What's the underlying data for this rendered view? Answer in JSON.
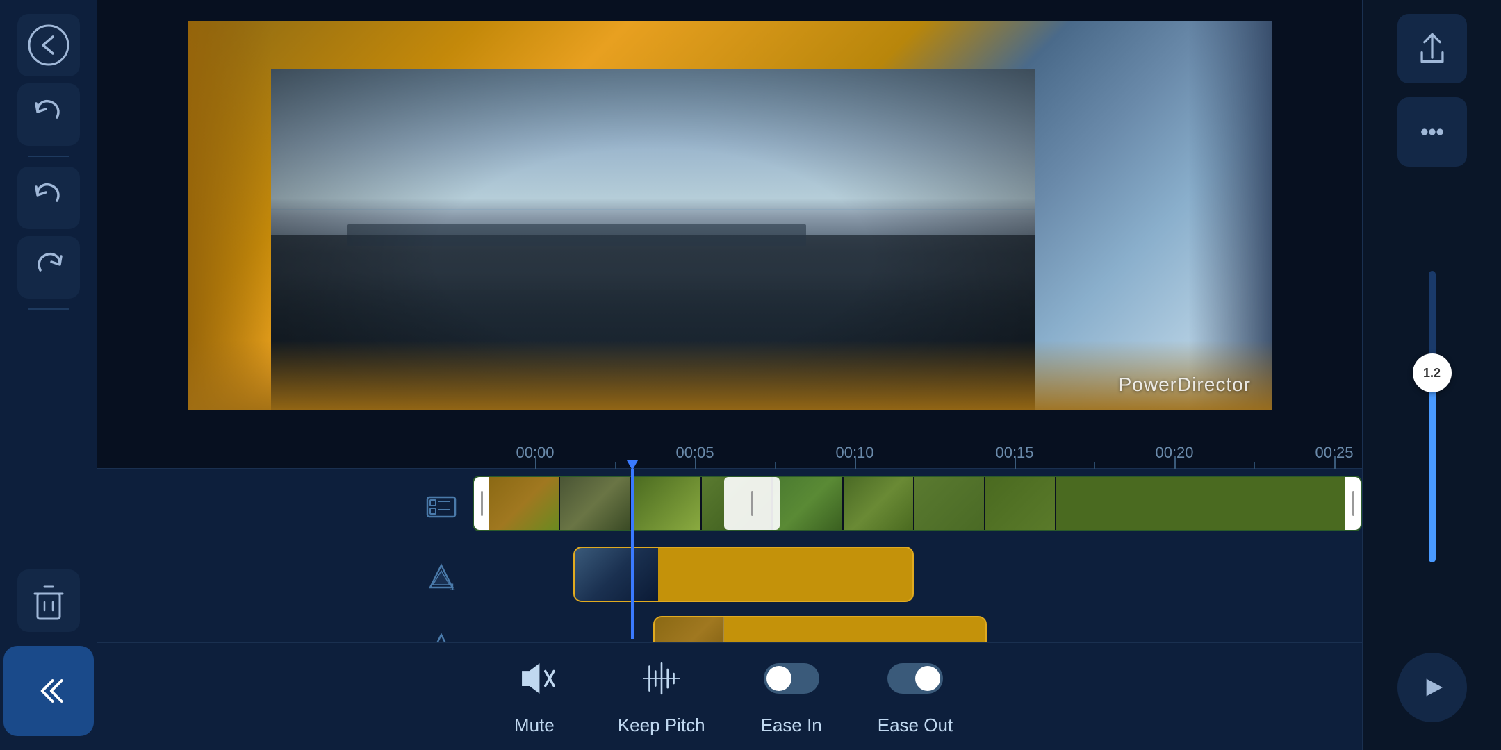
{
  "app": {
    "title": "PowerDirector",
    "watermark": "PowerDirector"
  },
  "sidebar": {
    "back_icon": "←",
    "undo_icon": "↩",
    "redo_icon": "↪",
    "delete_icon": "🗑",
    "collapse_icon": "«"
  },
  "right_panel": {
    "share_icon": "⬆",
    "more_icon": "•••",
    "volume_value": "1.2",
    "play_icon": "▶"
  },
  "timeline": {
    "ruler_marks": [
      "00:00",
      "00:05",
      "00:10",
      "00:15",
      "00:20",
      "00:25"
    ]
  },
  "toolbar": {
    "mute_label": "Mute",
    "keep_pitch_label": "Keep Pitch",
    "ease_in_label": "Ease In",
    "ease_out_label": "Ease Out"
  }
}
